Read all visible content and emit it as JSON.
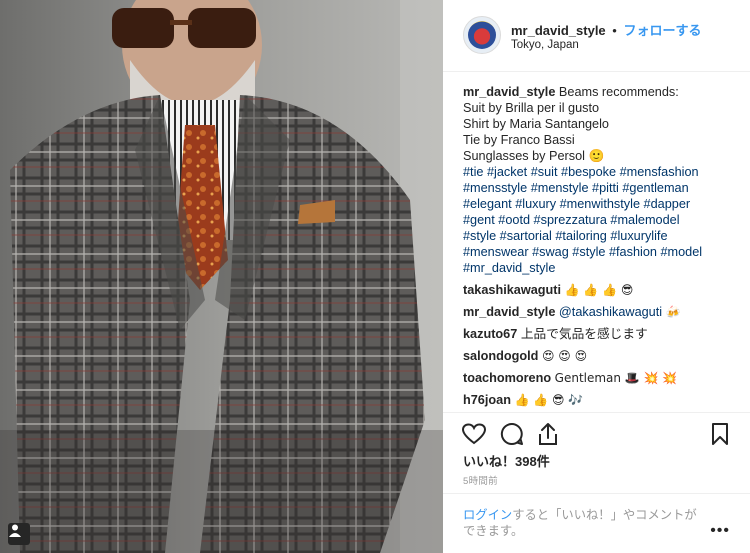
{
  "post": {
    "username": "mr_david_style",
    "separator": "•",
    "follow_label": "フォローする",
    "location": "Tokyo, Japan",
    "avatar_alt": "mr_david_style"
  },
  "caption": {
    "username": "mr_david_style",
    "lines": [
      "Beams recommends:",
      "Suit by Brilla per il gusto",
      "Shirt by Maria Santangelo",
      "Tie by Franco Bassi",
      "Sunglasses by Persol 🙂"
    ],
    "hashtag_lines": [
      "#tie #jacket #suit #bespoke #mensfashion",
      "#mensstyle #menstyle #pitti #gentleman",
      "#elegant #luxury #menwithstyle #dapper",
      "#gent #ootd #sprezzatura #malemodel",
      "#style #sartorial #tailoring #luxurylife",
      "#menswear #swag #style #fashion #model",
      "#mr_david_style"
    ]
  },
  "comments": [
    {
      "user": "takashikawaguti",
      "text": "👍 👍 👍 😎",
      "mention": ""
    },
    {
      "user": "mr_david_style",
      "text": "🍻",
      "mention": "@takashikawaguti"
    },
    {
      "user": "kazuto67",
      "text": "上品で気品を感じます",
      "mention": ""
    },
    {
      "user": "salondogold",
      "text": "😍 😍 😍",
      "mention": ""
    },
    {
      "user": "toachomoreno",
      "text": "Gentleman 🎩 💥 💥",
      "mention": ""
    },
    {
      "user": "h76joan",
      "text": "👍 👍 😎 🎶",
      "mention": ""
    }
  ],
  "actions": {
    "like_icon": "heart-icon",
    "comment_icon": "comment-icon",
    "share_icon": "share-icon",
    "save_icon": "bookmark-icon"
  },
  "likes": "いいね！398件",
  "time_ago": "5時間前",
  "login": {
    "link": "ログイン",
    "text": "すると「いいね！」やコメントができます。",
    "more": "•••"
  },
  "colors": {
    "link_blue": "#3897f0",
    "hashtag_blue": "#003569",
    "text": "#262626",
    "muted": "#999999"
  }
}
